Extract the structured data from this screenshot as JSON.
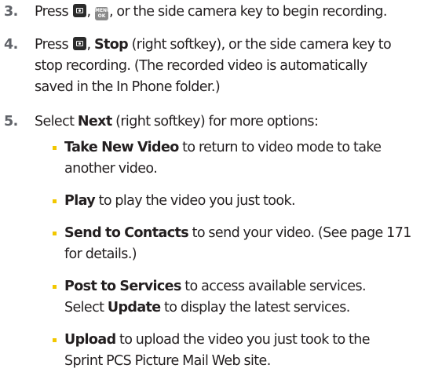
{
  "steps": [
    {
      "number": "3.",
      "parts": {
        "a": "Press",
        "b": ",",
        "c": ", or the side camera key to begin recording."
      },
      "icons": [
        "camera-key-icon",
        "menu-ok-key-icon"
      ]
    },
    {
      "number": "4.",
      "lines": {
        "l1a": "Press",
        "l1b": ",",
        "l1bold": "Stop",
        "l1c": "(right softkey), or the side camera key to",
        "l2": "stop recording. (The recorded video is automatically",
        "l3": "saved in the In Phone folder.)"
      },
      "icons": [
        "camera-key-icon"
      ]
    },
    {
      "number": "5.",
      "pre": "Select",
      "bold": "Next",
      "post": "(right softkey) for more options:"
    }
  ],
  "menu_ok_key": {
    "line1": "MENU",
    "line2": "OK"
  },
  "options": [
    {
      "bold": "Take New Video",
      "line1": "to return to video mode to take",
      "line2": "another video."
    },
    {
      "bold": "Play",
      "line1": "to play the video you just took."
    },
    {
      "bold": "Send to Contacts",
      "line1": "to send your video. (See page 171",
      "line2": "for details.)"
    },
    {
      "bold": "Post to Services",
      "line1": "to access available services.",
      "line2a": "Select",
      "line2bold": "Update",
      "line2b": "to display the latest services."
    },
    {
      "bold": "Upload",
      "line1": "to upload the video you just took to the",
      "line2": "Sprint PCS Picture Mail Web site."
    }
  ],
  "colors": {
    "text": "#231f20",
    "step_number": "#5f6268",
    "bullet": "#f2c700",
    "key_dark": "#2b2b2b",
    "key_gray": "#8a8a8a"
  }
}
